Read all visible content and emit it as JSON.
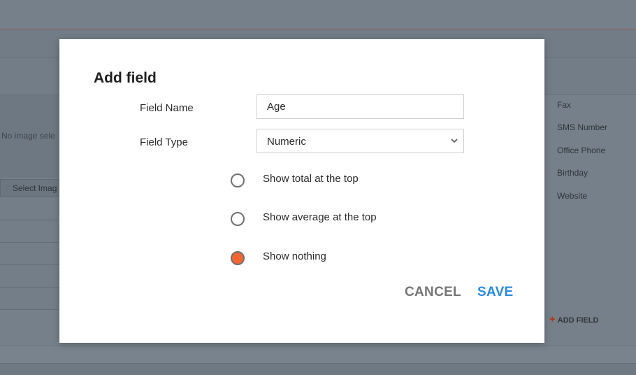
{
  "background": {
    "no_image_text": "No image sele",
    "select_image_label": "Select Imag",
    "right_list": [
      "Fax",
      "SMS Number",
      "Office Phone",
      "Birthday",
      "Website"
    ],
    "add_field_label": "ADD FIELD",
    "add_field_icon": "plus-icon",
    "add_field_icon_glyph": "+"
  },
  "modal": {
    "title": "Add field",
    "field_name_label": "Field Name",
    "field_name_value": "Age",
    "field_type_label": "Field Type",
    "field_type_value": "Numeric",
    "options": [
      {
        "label": "Show total at the top",
        "selected": false
      },
      {
        "label": "Show average at the top",
        "selected": false
      },
      {
        "label": "Show nothing",
        "selected": true
      }
    ],
    "cancel_label": "CANCEL",
    "save_label": "SAVE"
  },
  "colors": {
    "accent_orange": "#f26633",
    "save_blue": "#2a8be0",
    "overlay": "#76808a"
  }
}
